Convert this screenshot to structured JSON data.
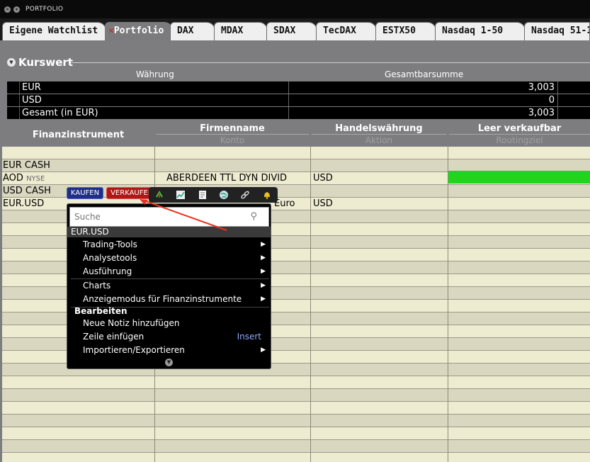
{
  "window": {
    "title": "PORTFOLIO"
  },
  "tabs": [
    {
      "label": "Eigene Watchlist"
    },
    {
      "label": "Portfolio",
      "active": true
    },
    {
      "label": "DAX"
    },
    {
      "label": "MDAX"
    },
    {
      "label": "SDAX"
    },
    {
      "label": "TecDAX"
    },
    {
      "label": "ESTX50"
    },
    {
      "label": "Nasdaq 1-50"
    },
    {
      "label": "Nasdaq 51-1"
    }
  ],
  "summary": {
    "title": "Kurswert",
    "col_currency": "Währung",
    "col_total": "Gesamtbarsumme",
    "rows": [
      {
        "currency": "EUR",
        "total": "3,003"
      },
      {
        "currency": "USD",
        "total": "0"
      },
      {
        "currency": "Gesamt (in EUR)",
        "total": "3,003"
      }
    ]
  },
  "grid": {
    "headers": {
      "instrument": "Finanzinstrument",
      "company": "Firmenname",
      "company_sub": "Konto",
      "currency": "Handelswährung",
      "currency_sub": "Aktion",
      "shortable": "Leer verkaufbar",
      "shortable_sub": "Routingziel"
    },
    "rows": [
      {
        "instrument": "",
        "exchange": "",
        "company": "",
        "currency": ""
      },
      {
        "instrument": "EUR CASH",
        "exchange": "",
        "company": "",
        "currency": ""
      },
      {
        "instrument": "AOD",
        "exchange": "NYSE",
        "company": "ABERDEEN TTL DYN DIVID",
        "currency": "USD"
      },
      {
        "instrument": "USD CASH",
        "exchange": "",
        "company": "",
        "currency": ""
      },
      {
        "instrument": "EUR.USD",
        "exchange": "",
        "company": "Euro",
        "currency": "USD"
      }
    ]
  },
  "trade": {
    "buy": "KAUFEN",
    "sell": "VERKAUFEN"
  },
  "toolbar_icons": [
    "arrows-icon",
    "chart-icon",
    "document-icon",
    "globe-icon",
    "link-icon",
    "bell-icon"
  ],
  "context_menu": {
    "search_placeholder": "Suche",
    "header": "EUR.USD",
    "items": [
      {
        "label": "Trading-Tools",
        "submenu": true
      },
      {
        "label": "Analysetools",
        "submenu": true
      },
      {
        "label": "Ausführung",
        "submenu": true
      },
      {
        "label": "Charts",
        "submenu": true
      },
      {
        "label": "Anzeigemodus für Finanzinstrumente",
        "submenu": true
      }
    ],
    "group": "Bearbeiten",
    "edit_items": [
      {
        "label": "Neue Notiz hinzufügen"
      },
      {
        "label": "Zeile einfügen",
        "shortcut": "Insert"
      },
      {
        "label": "Importieren/Exportieren",
        "submenu": true
      }
    ]
  },
  "colors": {
    "accent_green": "#21d51e",
    "buy": "#1f2e8a",
    "sell": "#b01818",
    "callout": "#e8331f"
  }
}
